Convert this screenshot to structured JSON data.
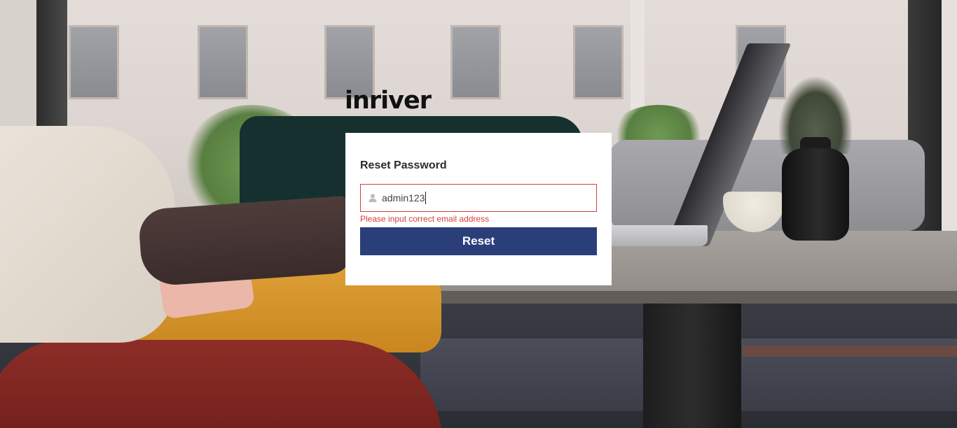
{
  "brand": {
    "logo_text": "inriver"
  },
  "reset_form": {
    "title": "Reset Password",
    "email_input": {
      "value": "admin123",
      "placeholder": "",
      "icon": "user-icon"
    },
    "error_message": "Please input correct email address",
    "submit_label": "Reset"
  },
  "colors": {
    "accent": "#2a3f7a",
    "error": "#d43f3a",
    "card_bg": "#ffffff"
  }
}
